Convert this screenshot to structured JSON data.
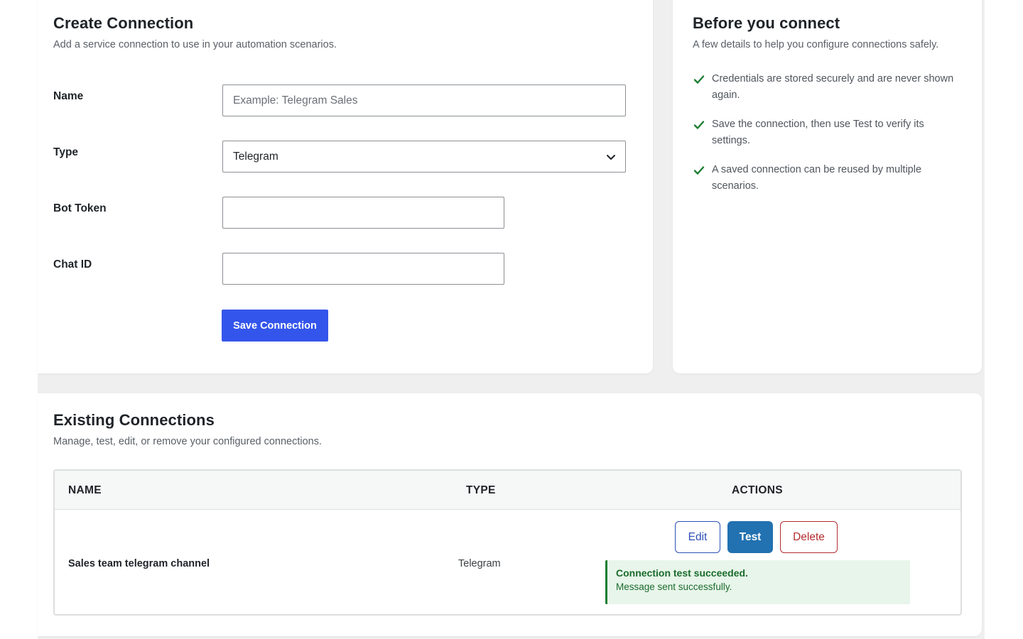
{
  "create": {
    "title": "Create Connection",
    "subtitle": "Add a service connection to use in your automation scenarios.",
    "fields": {
      "name_label": "Name",
      "name_placeholder": "Example: Telegram Sales",
      "type_label": "Type",
      "type_value": "Telegram",
      "bot_token_label": "Bot Token",
      "bot_token_value": "",
      "chat_id_label": "Chat ID",
      "chat_id_value": ""
    },
    "save_label": "Save Connection"
  },
  "before": {
    "title": "Before you connect",
    "subtitle": "A few details to help you configure connections safely.",
    "tips": [
      "Credentials are stored securely and are never shown again.",
      "Save the connection, then use Test to verify its settings.",
      "A saved connection can be reused by multiple scenarios."
    ]
  },
  "existing": {
    "title": "Existing Connections",
    "subtitle": "Manage, test, edit, or remove your configured connections.",
    "columns": [
      "NAME",
      "TYPE",
      "ACTIONS"
    ],
    "rows": [
      {
        "name": "Sales team telegram channel",
        "type": "Telegram",
        "actions": {
          "edit": "Edit",
          "test": "Test",
          "delete": "Delete"
        },
        "notice": {
          "title": "Connection test succeeded.",
          "message": "Message sent successfully."
        }
      }
    ]
  },
  "colors": {
    "primary": "#3455eb",
    "test": "#2271b1",
    "delete": "#b32d2e",
    "success": "#1a6b2c",
    "check": "#1e7e34"
  },
  "icons": {
    "select_chevron": "chevron-down-icon",
    "tip_check": "check-icon"
  }
}
